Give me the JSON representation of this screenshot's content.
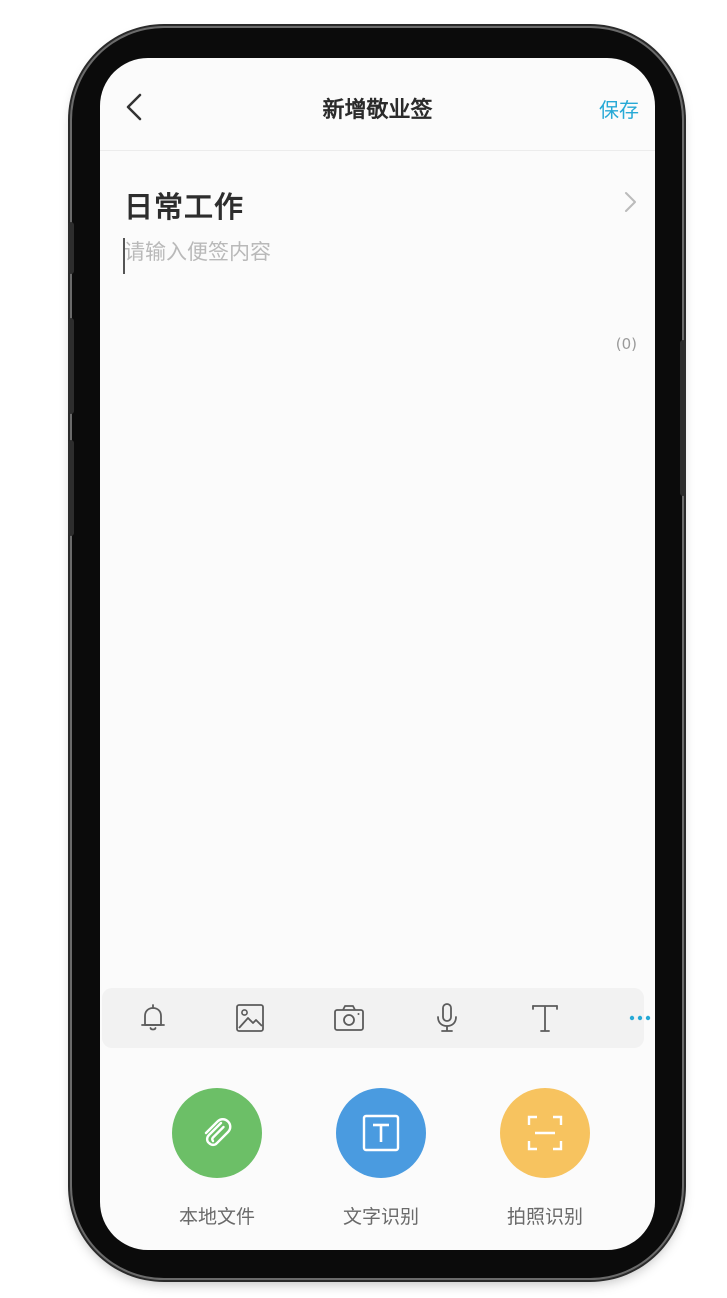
{
  "header": {
    "title": "新增敬业签",
    "save_label": "保存"
  },
  "category": {
    "name": "日常工作"
  },
  "editor": {
    "placeholder": "请输入便签内容",
    "value": "",
    "char_count": "(0)"
  },
  "toolbar": {
    "items": [
      "bell-icon",
      "image-icon",
      "camera-icon",
      "microphone-icon",
      "text-format-icon",
      "more-icon"
    ],
    "accent_color": "#27a9d6"
  },
  "actions": [
    {
      "label": "本地文件",
      "icon": "paperclip-icon",
      "color": "#6cbf67"
    },
    {
      "label": "文字识别",
      "icon": "text-recognition-icon",
      "color": "#4a9be0"
    },
    {
      "label": "拍照识别",
      "icon": "scan-icon",
      "color": "#f7c35f"
    }
  ]
}
